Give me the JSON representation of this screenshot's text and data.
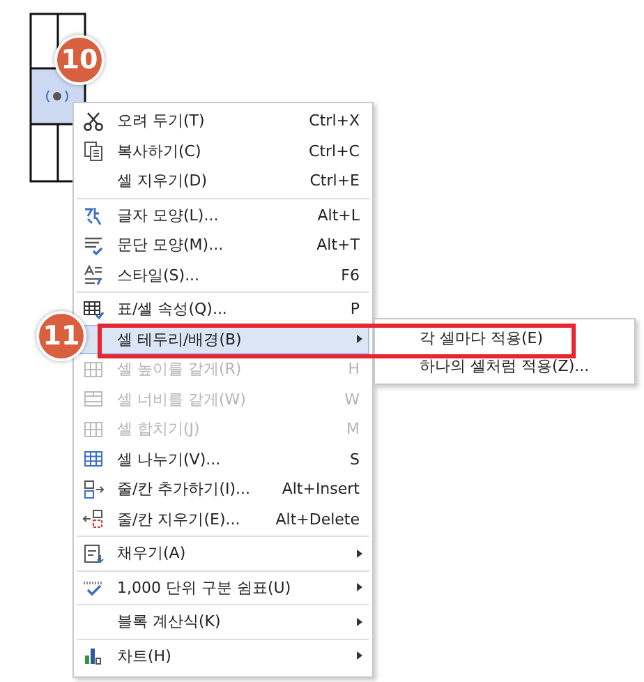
{
  "callouts": [
    {
      "number": "10"
    },
    {
      "number": "11"
    }
  ],
  "context_menu": {
    "items": [
      {
        "kind": "item",
        "label": "오려 두기(T)",
        "shortcut": "Ctrl+X",
        "disabled": false,
        "submenu": false,
        "selected": false
      },
      {
        "kind": "item",
        "label": "복사하기(C)",
        "shortcut": "Ctrl+C",
        "disabled": false,
        "submenu": false,
        "selected": false
      },
      {
        "kind": "item",
        "label": "셀 지우기(D)",
        "shortcut": "Ctrl+E",
        "disabled": false,
        "submenu": false,
        "selected": false
      },
      {
        "kind": "separator"
      },
      {
        "kind": "item",
        "label": "글자 모양(L)...",
        "shortcut": "Alt+L",
        "disabled": false,
        "submenu": false,
        "selected": false
      },
      {
        "kind": "item",
        "label": "문단 모양(M)...",
        "shortcut": "Alt+T",
        "disabled": false,
        "submenu": false,
        "selected": false
      },
      {
        "kind": "item",
        "label": "스타일(S)...",
        "shortcut": "F6",
        "disabled": false,
        "submenu": false,
        "selected": false
      },
      {
        "kind": "separator"
      },
      {
        "kind": "item",
        "label": "표/셀 속성(Q)...",
        "shortcut": "P",
        "disabled": false,
        "submenu": false,
        "selected": false
      },
      {
        "kind": "item",
        "label": "셀 테두리/배경(B)",
        "disabled": false,
        "submenu": true,
        "selected": true
      },
      {
        "kind": "item",
        "label": "셀 높이를 같게(R)",
        "shortcut": "H",
        "disabled": true,
        "submenu": false,
        "selected": false
      },
      {
        "kind": "item",
        "label": "셀 너비를 같게(W)",
        "shortcut": "W",
        "disabled": true,
        "submenu": false,
        "selected": false
      },
      {
        "kind": "item",
        "label": "셀 합치기(J)",
        "shortcut": "M",
        "disabled": true,
        "submenu": false,
        "selected": false
      },
      {
        "kind": "item",
        "label": "셀 나누기(V)...",
        "shortcut": "S",
        "disabled": false,
        "submenu": false,
        "selected": false
      },
      {
        "kind": "item",
        "label": "줄/칸 추가하기(I)...",
        "shortcut": "Alt+Insert",
        "disabled": false,
        "submenu": false,
        "selected": false
      },
      {
        "kind": "item",
        "label": "줄/칸 지우기(E)...",
        "shortcut": "Alt+Delete",
        "disabled": false,
        "submenu": false,
        "selected": false
      },
      {
        "kind": "separator"
      },
      {
        "kind": "item",
        "label": "채우기(A)",
        "disabled": false,
        "submenu": true,
        "selected": false
      },
      {
        "kind": "separator"
      },
      {
        "kind": "item",
        "label": "1,000 단위 구분 쉼표(U)",
        "disabled": false,
        "submenu": true,
        "selected": false
      },
      {
        "kind": "separator"
      },
      {
        "kind": "item",
        "label": "블록 계산식(K)",
        "disabled": false,
        "submenu": true,
        "selected": false
      },
      {
        "kind": "separator"
      },
      {
        "kind": "item",
        "label": "차트(H)",
        "disabled": false,
        "submenu": true,
        "selected": false
      }
    ]
  },
  "submenu": {
    "items": [
      {
        "label": "각 셀마다 적용(E)"
      },
      {
        "label": "하나의 셀처럼 적용(Z)..."
      }
    ]
  }
}
